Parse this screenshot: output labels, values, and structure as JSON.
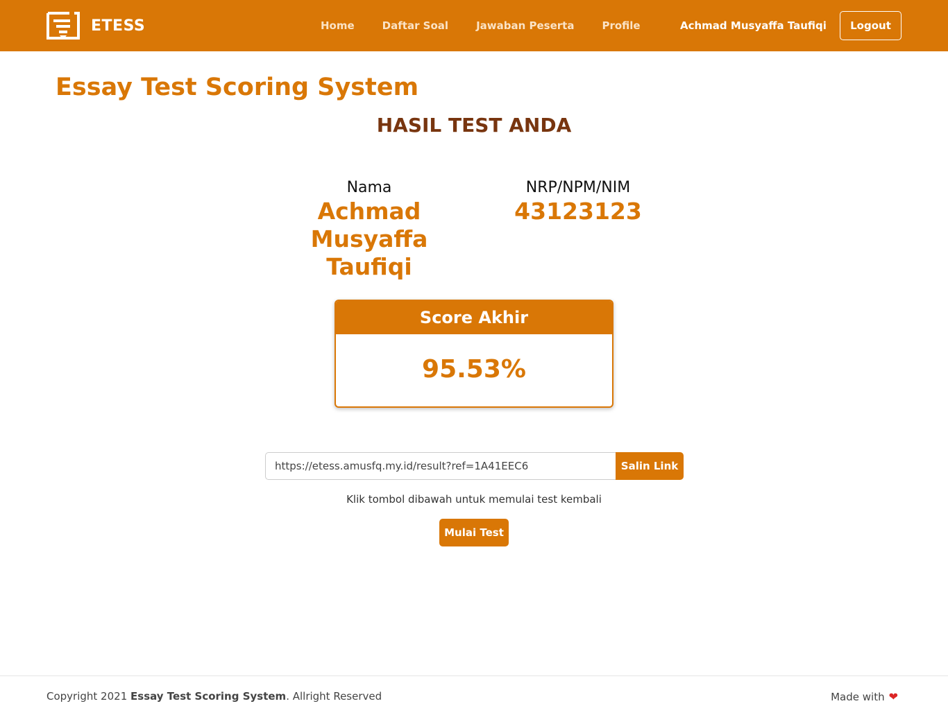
{
  "brand": {
    "name": "ETESS",
    "icon": "document-list-icon"
  },
  "nav": {
    "links": [
      "Home",
      "Daftar Soal",
      "Jawaban Peserta",
      "Profile"
    ],
    "user": "Achmad Musyaffa Taufiqi",
    "logout_label": "Logout"
  },
  "main": {
    "app_title": "Essay Test Scoring System",
    "result_heading": "HASIL TEST ANDA",
    "name_label": "Nama",
    "name_value": "Achmad Musyaffa Taufiqi",
    "id_label": "NRP/NPM/NIM",
    "id_value": "43123123",
    "score_label": "Score Akhir",
    "score_value": "95.53%",
    "share_link": "https://etess.amusfq.my.id/result?ref=1A41EEC6",
    "copy_label": "Salin Link",
    "hint": "Klik tombol dibawah untuk memulai test kembali",
    "start_label": "Mulai Test"
  },
  "footer": {
    "copyright_prefix": "Copyright 2021 ",
    "copyright_brand": "Essay Test Scoring System",
    "copyright_suffix": ". Allright Reserved",
    "made_with": "Made with",
    "heart_icon": "heart-icon"
  },
  "colors": {
    "primary": "#d97706",
    "heading_dark": "#78350f",
    "heart": "#dc2626"
  }
}
